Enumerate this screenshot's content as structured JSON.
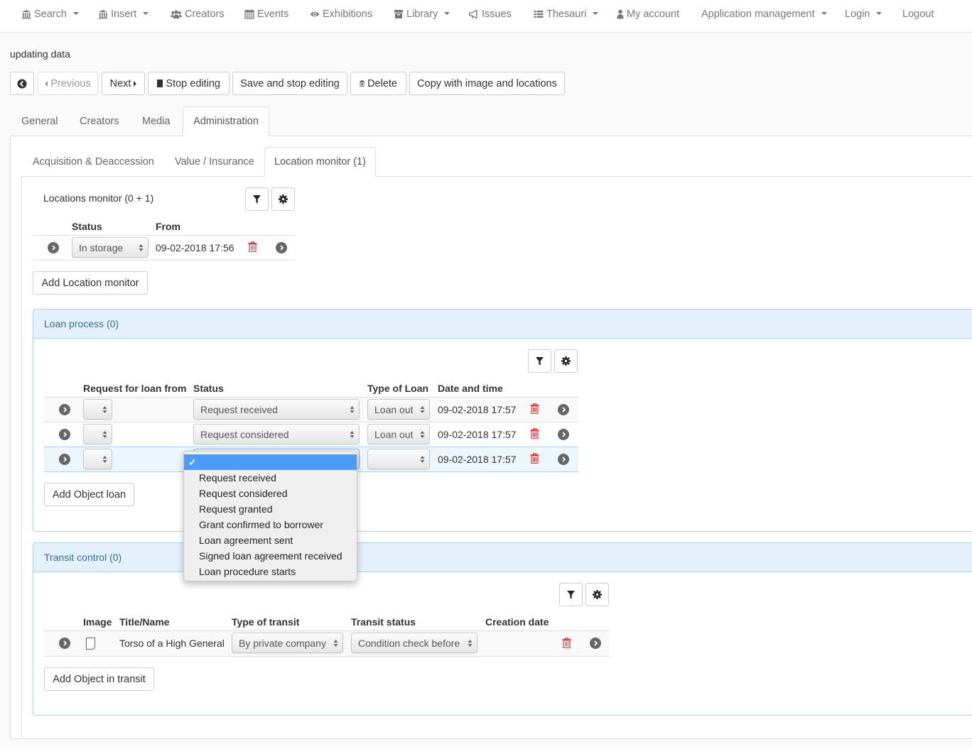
{
  "navbar": {
    "items": [
      {
        "label": "Search",
        "icon": "bank-icon",
        "dropdown": true
      },
      {
        "label": "Insert",
        "icon": "bank-icon",
        "dropdown": true
      },
      {
        "label": "Creators",
        "icon": "users-icon",
        "dropdown": false
      },
      {
        "label": "Events",
        "icon": "calendar-icon",
        "dropdown": false
      },
      {
        "label": "Exhibitions",
        "icon": "eye-icon",
        "dropdown": false
      },
      {
        "label": "Library",
        "icon": "archive-icon",
        "dropdown": true
      },
      {
        "label": "Issues",
        "icon": "bullhorn-icon",
        "dropdown": false
      },
      {
        "label": "Thesauri",
        "icon": "list-icon",
        "dropdown": true
      },
      {
        "label": "My account",
        "icon": "user-icon",
        "dropdown": false
      },
      {
        "label": "Application management",
        "icon": "",
        "dropdown": true
      },
      {
        "label": "Login",
        "icon": "",
        "dropdown": true
      },
      {
        "label": "Logout",
        "icon": "",
        "dropdown": false
      }
    ]
  },
  "page": {
    "title": "updating data"
  },
  "toolbar": {
    "back_label": "",
    "previous_label": "Previous",
    "next_label": "Next",
    "stop_editing_label": "Stop editing",
    "save_stop_label": "Save and stop editing",
    "delete_label": "Delete",
    "copy_label": "Copy with image and locations"
  },
  "main_tabs": [
    {
      "label": "General",
      "active": false
    },
    {
      "label": "Creators",
      "active": false
    },
    {
      "label": "Media",
      "active": false
    },
    {
      "label": "Administration",
      "active": true
    }
  ],
  "sub_tabs": [
    {
      "label": "Acquisition & Deaccession",
      "active": false
    },
    {
      "label": "Value / Insurance",
      "active": false
    },
    {
      "label": "Location monitor (1)",
      "active": true
    }
  ],
  "locations_monitor": {
    "title": "Locations monitor (0 + 1)",
    "columns": [
      "Status",
      "From"
    ],
    "rows": [
      {
        "status": "In storage",
        "from": "09-02-2018 17:56"
      }
    ],
    "add_label": "Add Location monitor"
  },
  "loan_process": {
    "title": "Loan process (0)",
    "columns": [
      "Request for loan from",
      "Status",
      "Type of Loan",
      "Date and time"
    ],
    "rows": [
      {
        "request_from": "",
        "status": "Request received",
        "type": "Loan out",
        "datetime": "09-02-2018 17:57"
      },
      {
        "request_from": "",
        "status": "Request considered",
        "type": "Loan out",
        "datetime": "09-02-2018 17:57"
      },
      {
        "request_from": "",
        "status": "",
        "type": "",
        "datetime": "09-02-2018 17:57"
      }
    ],
    "add_label": "Add Object loan",
    "status_dropdown": {
      "selected_mark": "✓",
      "options": [
        "",
        "Request received",
        "Request considered",
        "Request granted",
        "Grant confirmed to borrower",
        "Loan agreement sent",
        "Signed loan agreement received",
        "Loan procedure starts"
      ]
    }
  },
  "transit_control": {
    "title": "Transit control (0)",
    "columns": [
      "Image",
      "Title/Name",
      "Type of transit",
      "Transit status",
      "Creation date"
    ],
    "rows": [
      {
        "title": "Torso of a High General",
        "type": "By private company",
        "status": "Condition check before",
        "created": ""
      }
    ],
    "add_label": "Add Object in transit"
  },
  "colors": {
    "panel_header_bg": "#e4f1fd",
    "panel_border": "#a9d2ef",
    "panel_title": "#31708f",
    "delete_red": "#e8363d",
    "dropdown_highlight": "#4a9cf6",
    "active_row_bg": "#eef6fd"
  }
}
